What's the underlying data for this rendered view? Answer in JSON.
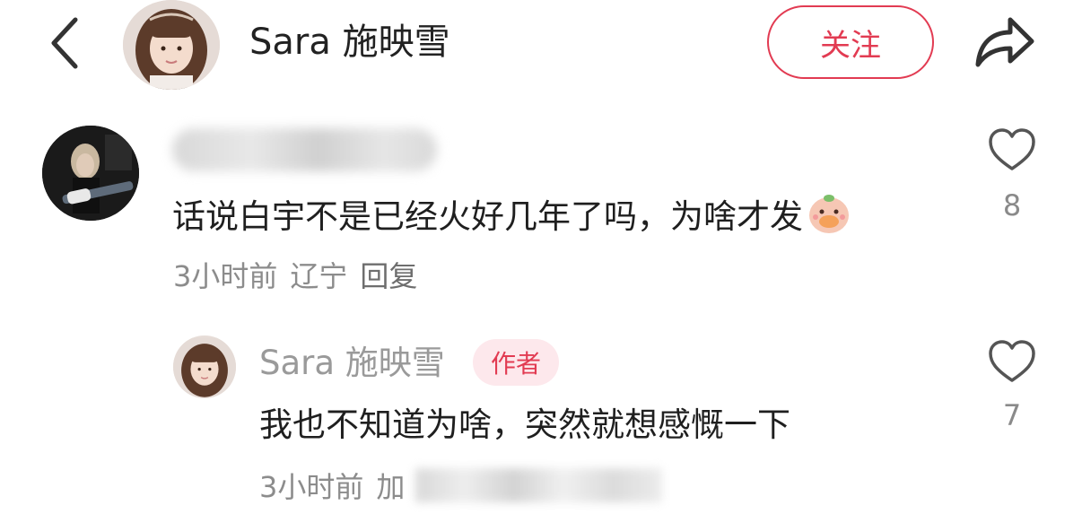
{
  "header": {
    "back_icon": "chevron-left-icon",
    "title": "Sara 施映雪",
    "follow_label": "关注",
    "share_icon": "share-arrow-icon",
    "accent_color": "#e23b52"
  },
  "comments": [
    {
      "text": "话说白宇不是已经火好几年了吗，为啥才发",
      "emoji_icon": "peach-eating-emoji-icon",
      "time": "3小时前",
      "location": "辽宁",
      "reply_label": "回复",
      "likes": "8",
      "like_icon": "heart-outline-icon"
    }
  ],
  "replies": [
    {
      "author": "Sara 施映雪",
      "badge": "作者",
      "text": "我也不知道为啥，突然就想感慨一下",
      "time": "3小时前",
      "location_partial": "加",
      "likes": "7",
      "like_icon": "heart-outline-icon"
    }
  ]
}
